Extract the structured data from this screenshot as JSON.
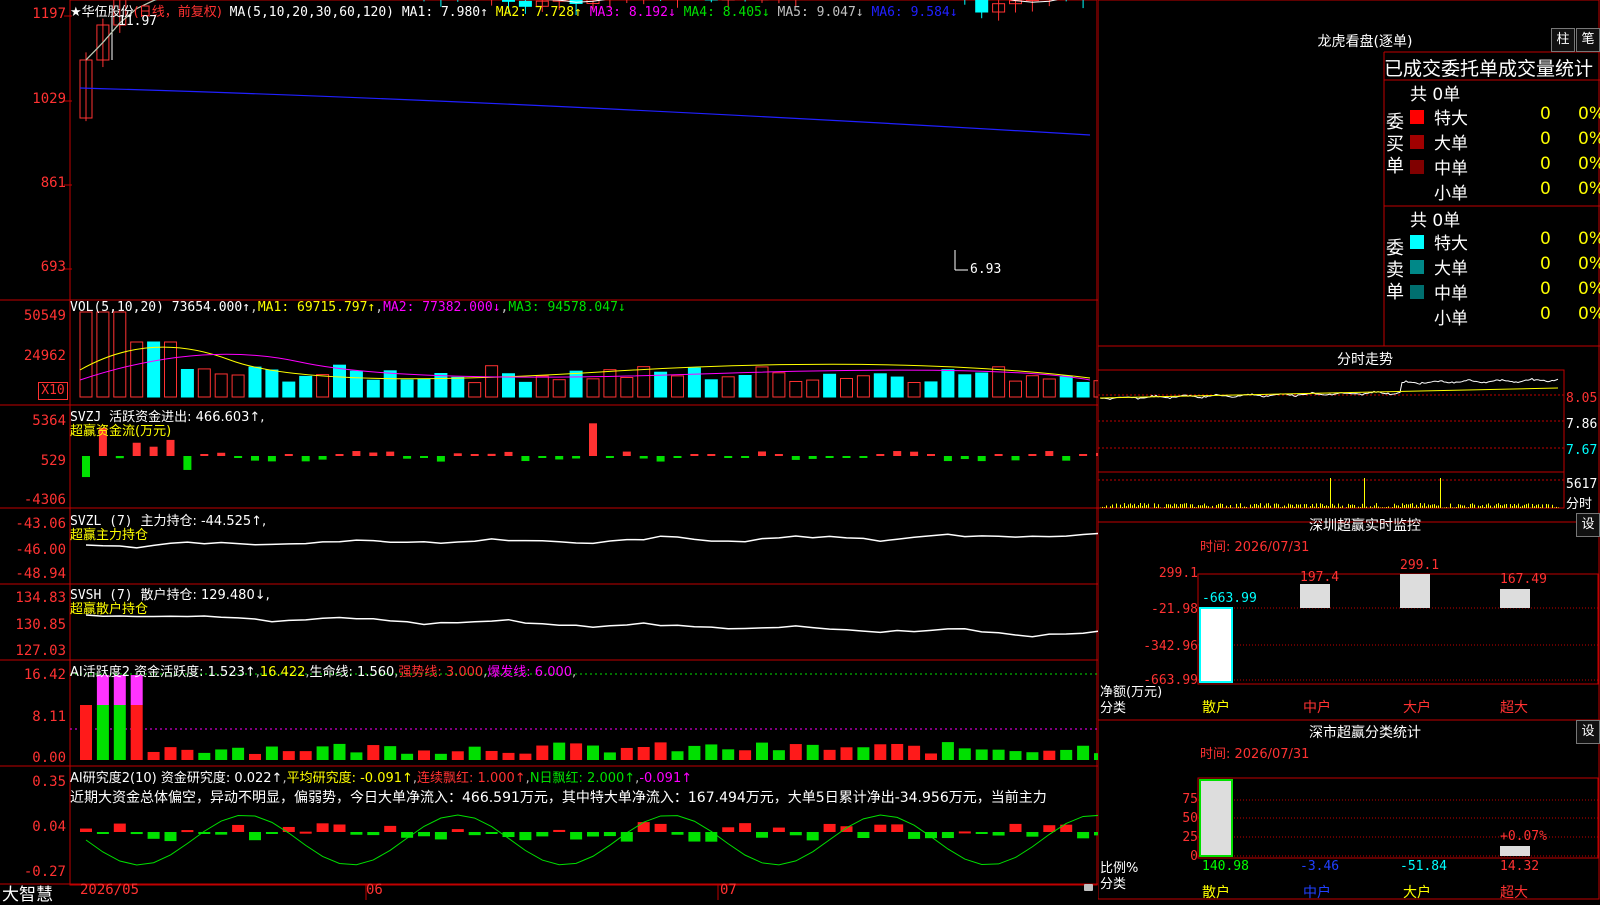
{
  "colors": {
    "up": "#ff3232",
    "down": "#00ffff",
    "grid": "#c00000",
    "ma1": "#ffffff",
    "ma2": "#ffff00",
    "ma3": "#ff00ff",
    "ma4": "#00e000",
    "ma5": "#c0c0c0",
    "ma6": "#2020ff"
  },
  "main": {
    "header": {
      "stock": "★华伍股份",
      "mode": "(日线，前复权)",
      "ma_label": "MA(5,10,20,30,60,120)",
      "ma1": "MA1: 7.980↑",
      "ma2": "MA2: 7.728↑",
      "ma3": "MA3: 8.192↓",
      "ma4": "MA4: 8.405↓",
      "ma5": "MA5: 9.047↓",
      "ma6": "MA6: 9.584↓"
    },
    "yticks": [
      "1197",
      "1029",
      "861",
      "693"
    ],
    "high_label": "11.97",
    "low_label": "6.93"
  },
  "vol": {
    "header": {
      "name": "VOL(5,10,20)",
      "value": "73654.000↑",
      "ma1": "MA1: 69715.797↑",
      "ma2": "MA2: 77382.000↓",
      "ma3": "MA3: 94578.047↓"
    },
    "yticks": [
      "50549",
      "24962"
    ],
    "unit": "X10"
  },
  "svzj": {
    "header": {
      "name": "SVZJ",
      "label": "活跃资金进出: 466.603↑,",
      "sub": "超赢资金流(万元)"
    },
    "yticks": [
      "5364",
      "529",
      "-4306"
    ]
  },
  "svzl": {
    "header": {
      "name": "SVZL (7)",
      "label": "主力持仓: -44.525↑,",
      "sub": "超赢主力持仓"
    },
    "yticks": [
      "-43.06",
      "-46.00",
      "-48.94"
    ]
  },
  "svsh": {
    "header": {
      "name": "SVSH (7)",
      "label": "散户持仓: 129.480↓,",
      "sub": "超赢散户持仓"
    },
    "yticks": [
      "134.83",
      "130.85",
      "127.03"
    ]
  },
  "aihyd": {
    "header": {
      "name": "AI活跃度2",
      "a": "资金活跃度: 1.523↑",
      "b": "16.422",
      "c": "生命线: 1.560",
      "d": "强势线: 3.000",
      "e": "爆发线: 6.000"
    },
    "yticks": [
      "16.42",
      "8.11",
      "0.00"
    ]
  },
  "aiyjd": {
    "header": {
      "name": "AI研究度2(10)",
      "a": "资金研究度: 0.022↑",
      "b": "平均研究度: -0.091↑",
      "c": "连续飘红: 1.000↑",
      "d": "N日飘红: 2.000↑",
      "e": "-0.091↑"
    },
    "comment": "近期大资金总体偏空，异动不明显，偏弱势，今日大单净流入：466.591万元，其中特大单净流入：167.494万元，大单5日累计净出-34.956万元，当前主力",
    "yticks": [
      "0.35",
      "0.04",
      "-0.27"
    ]
  },
  "xaxis": {
    "brand": "大智慧",
    "labels": [
      "2026/05",
      "06",
      "07"
    ]
  },
  "dragon": {
    "title": "龙虎看盘(逐单)",
    "btn_zhu": "柱",
    "btn_bi": "笔",
    "subtitle": "已成交委托单成交量统计",
    "buy_label": "委买单",
    "buy_total": "共 0单",
    "sell_label": "委卖单",
    "sell_total": "共 0单",
    "buy_rows": [
      {
        "name": "特大",
        "v": "0",
        "p": "0%",
        "c": "#ff0000"
      },
      {
        "name": "大单",
        "v": "0",
        "p": "0%",
        "c": "#a00000"
      },
      {
        "name": "中单",
        "v": "0",
        "p": "0%",
        "c": "#800000"
      },
      {
        "name": "小单",
        "v": "0",
        "p": "0%",
        "c": ""
      }
    ],
    "sell_rows": [
      {
        "name": "特大",
        "v": "0",
        "p": "0%",
        "c": "#00ffff"
      },
      {
        "name": "大单",
        "v": "0",
        "p": "0%",
        "c": "#008888"
      },
      {
        "name": "中单",
        "v": "0",
        "p": "0%",
        "c": "#006f6f"
      },
      {
        "name": "小单",
        "v": "0",
        "p": "0%",
        "c": ""
      }
    ]
  },
  "intraday": {
    "title": "分时走势",
    "yticks": [
      "8.05",
      "7.86",
      "7.67"
    ],
    "vol_label": "5617",
    "vol_unit": "分时"
  },
  "monitor": {
    "title": "深圳超赢实时监控",
    "btn": "设",
    "time": "时间: 2026/07/31",
    "yticks": [
      "299.1",
      "-21.98",
      "-342.96",
      "-663.99"
    ],
    "net_label": "净额(万元)",
    "cat_label": "分类",
    "cats": [
      "散户",
      "中户",
      "大户",
      "超大"
    ],
    "values": [
      -663.99,
      197.4,
      299.1,
      167.49
    ],
    "value_labels": [
      "-663.99",
      "197.4",
      "299.1",
      "167.49"
    ]
  },
  "classify": {
    "title": "深市超赢分类统计",
    "btn": "设",
    "time": "时间: 2026/07/31",
    "yticks": [
      "75",
      "50",
      "25",
      "0"
    ],
    "ratio_label": "比例%",
    "cat_label": "分类",
    "cats": [
      "散户",
      "中户",
      "大户",
      "超大"
    ],
    "values": [
      "140.98",
      "-3.46",
      "-51.84",
      "14.32"
    ],
    "pct_label": "+0.07%"
  }
}
